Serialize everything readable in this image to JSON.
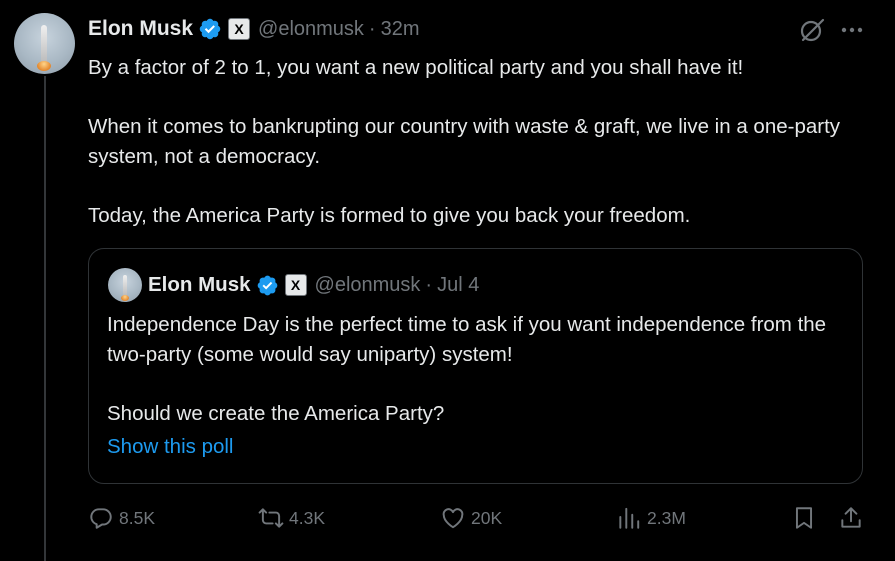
{
  "tweet": {
    "author_name": "Elon Musk",
    "verified_icon": "verified-badge-icon",
    "affiliate_icon": "x-logo-icon",
    "affiliate_glyph": "X",
    "handle": "@elonmusk",
    "separator": "·",
    "time": "32m",
    "paragraphs": [
      "By a factor of 2 to 1, you want a new political party and you shall have it!",
      "When it comes to bankrupting our country with waste & graft, we live in a one-party system, not a democracy.",
      "Today, the America Party is formed to give you back your freedom."
    ]
  },
  "quoted_tweet": {
    "author_name": "Elon Musk",
    "affiliate_glyph": "X",
    "handle": "@elonmusk",
    "separator": "·",
    "time": "Jul 4",
    "paragraphs": [
      "Independence Day is the perfect time to ask if you want independence from the two-party (some would say uniparty) system!",
      "Should we create the America Party?"
    ],
    "poll_link": "Show this poll"
  },
  "actions": {
    "replies": "8.5K",
    "reposts": "4.3K",
    "likes": "20K",
    "views": "2.3M"
  },
  "colors": {
    "background": "#000000",
    "text": "#e7e9ea",
    "secondary": "#71767b",
    "accent": "#1d9bf0",
    "border": "#2f3336"
  }
}
